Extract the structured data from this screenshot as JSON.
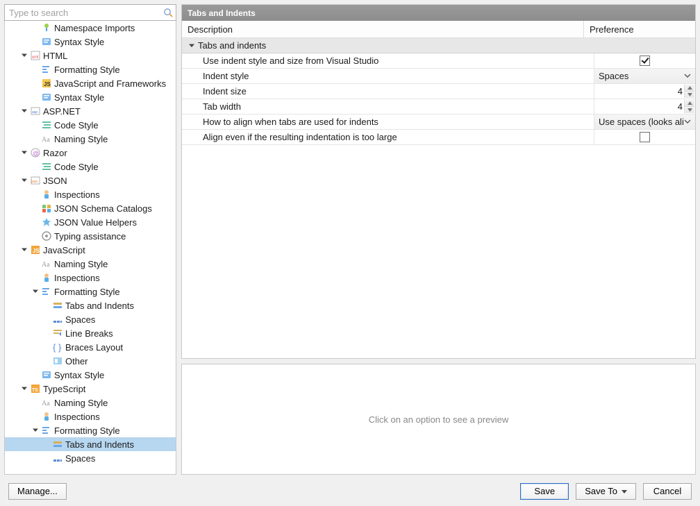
{
  "search": {
    "placeholder": "Type to search"
  },
  "panel": {
    "title": "Tabs and Indents",
    "columns": {
      "description": "Description",
      "preference": "Preference"
    },
    "group_label": "Tabs and indents"
  },
  "settings": [
    {
      "id": "use_vs",
      "label": "Use indent style and size from Visual Studio",
      "type": "checkbox",
      "value": true
    },
    {
      "id": "indent_style",
      "label": "Indent style",
      "type": "dropdown",
      "value": "Spaces"
    },
    {
      "id": "indent_size",
      "label": "Indent size",
      "type": "number",
      "value": 4
    },
    {
      "id": "tab_width",
      "label": "Tab width",
      "type": "number",
      "value": 4
    },
    {
      "id": "align_tabs",
      "label": "How to align when tabs are used for indents",
      "type": "dropdown",
      "value": "Use spaces (looks aligned"
    },
    {
      "id": "align_large",
      "label": "Align even if the resulting indentation is too large",
      "type": "checkbox",
      "value": false
    }
  ],
  "preview_hint": "Click on an option to see a preview",
  "footer": {
    "manage": "Manage...",
    "save": "Save",
    "saveto": "Save To",
    "cancel": "Cancel"
  },
  "tree": [
    {
      "depth": 2,
      "icon": "import",
      "label": "Namespace Imports"
    },
    {
      "depth": 2,
      "icon": "syntax",
      "label": "Syntax Style"
    },
    {
      "depth": 1,
      "icon": "html",
      "label": "HTML",
      "expanded": true
    },
    {
      "depth": 2,
      "icon": "format",
      "label": "Formatting Style"
    },
    {
      "depth": 2,
      "icon": "js",
      "label": "JavaScript and Frameworks"
    },
    {
      "depth": 2,
      "icon": "syntax",
      "label": "Syntax Style"
    },
    {
      "depth": 1,
      "icon": "asp",
      "label": "ASP.NET",
      "expanded": true
    },
    {
      "depth": 2,
      "icon": "code",
      "label": "Code Style"
    },
    {
      "depth": 2,
      "icon": "naming",
      "label": "Naming Style"
    },
    {
      "depth": 1,
      "icon": "razor",
      "label": "Razor",
      "expanded": true
    },
    {
      "depth": 2,
      "icon": "code",
      "label": "Code Style"
    },
    {
      "depth": 1,
      "icon": "json",
      "label": "JSON",
      "expanded": true
    },
    {
      "depth": 2,
      "icon": "inspect",
      "label": "Inspections"
    },
    {
      "depth": 2,
      "icon": "schema",
      "label": "JSON Schema Catalogs"
    },
    {
      "depth": 2,
      "icon": "helpers",
      "label": "JSON Value Helpers"
    },
    {
      "depth": 2,
      "icon": "typing",
      "label": "Typing assistance"
    },
    {
      "depth": 1,
      "icon": "js2",
      "label": "JavaScript",
      "expanded": true
    },
    {
      "depth": 2,
      "icon": "naming",
      "label": "Naming Style"
    },
    {
      "depth": 2,
      "icon": "inspect",
      "label": "Inspections"
    },
    {
      "depth": 2,
      "icon": "format",
      "label": "Formatting Style",
      "expanded": true
    },
    {
      "depth": 3,
      "icon": "tabs",
      "label": "Tabs and Indents"
    },
    {
      "depth": 3,
      "icon": "spaces",
      "label": "Spaces"
    },
    {
      "depth": 3,
      "icon": "breaks",
      "label": "Line Breaks"
    },
    {
      "depth": 3,
      "icon": "braces",
      "label": "Braces Layout"
    },
    {
      "depth": 3,
      "icon": "other",
      "label": "Other"
    },
    {
      "depth": 2,
      "icon": "syntax",
      "label": "Syntax Style"
    },
    {
      "depth": 1,
      "icon": "ts",
      "label": "TypeScript",
      "expanded": true
    },
    {
      "depth": 2,
      "icon": "naming",
      "label": "Naming Style"
    },
    {
      "depth": 2,
      "icon": "inspect",
      "label": "Inspections"
    },
    {
      "depth": 2,
      "icon": "format",
      "label": "Formatting Style",
      "expanded": true
    },
    {
      "depth": 3,
      "icon": "tabs",
      "label": "Tabs and Indents",
      "selected": true
    },
    {
      "depth": 3,
      "icon": "spaces",
      "label": "Spaces"
    }
  ]
}
